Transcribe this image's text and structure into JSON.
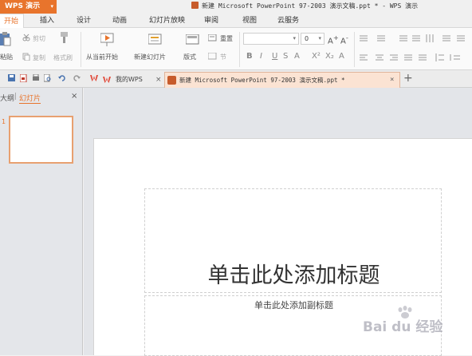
{
  "app": {
    "name": "WPS 演示",
    "caret": "▾"
  },
  "window_title": "新建 Microsoft PowerPoint 97-2003 演示文稿.ppt * - WPS 演示",
  "menu_tabs": [
    "开始",
    "插入",
    "设计",
    "动画",
    "幻灯片放映",
    "审阅",
    "视图",
    "云服务"
  ],
  "ribbon": {
    "paste": "粘贴",
    "cut": "剪切",
    "copy": "复制",
    "format_painter": "格式刷",
    "from_current": "从当前开始",
    "new_slide": "新建幻灯片",
    "layout": "版式",
    "reset": "重置",
    "section": "节",
    "font_name": "",
    "font_size": "0"
  },
  "doc_tabs": {
    "home": "我的WPS",
    "file": "新建 Microsoft PowerPoint 97-2003 演示文稿.ppt *"
  },
  "left_panel": {
    "outline_tab": "大纲",
    "slides_tab": "幻灯片",
    "slide_number": "1"
  },
  "slide": {
    "title_placeholder": "单击此处添加标题",
    "subtitle_placeholder": "单击此处添加副标题"
  },
  "watermark": {
    "text": "Bai du 经验"
  },
  "colors": {
    "accent": "#e8742c",
    "active_tab_bg": "#fbe3d3"
  }
}
